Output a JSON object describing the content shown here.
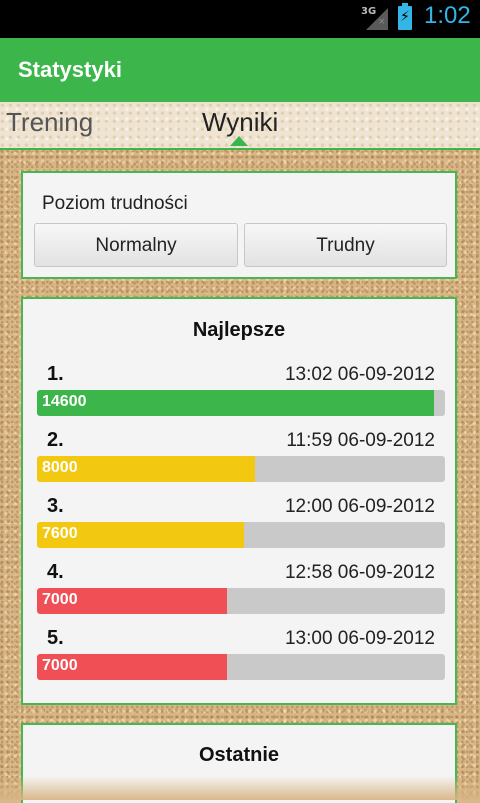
{
  "status_bar": {
    "network": "3G",
    "time": "1:02",
    "icons": [
      "signal-icon",
      "battery-charging-icon"
    ]
  },
  "app": {
    "title": "Statystyki"
  },
  "tabs": [
    {
      "label": "Trening",
      "selected": false
    },
    {
      "label": "Wyniki",
      "selected": true
    }
  ],
  "difficulty": {
    "label": "Poziom trudności",
    "options": [
      "Normalny",
      "Trudny"
    ]
  },
  "best": {
    "title": "Najlepsze",
    "max_score": 15000,
    "entries": [
      {
        "rank": "1.",
        "date": "13:02 06-09-2012",
        "score": "14600",
        "value": 14600,
        "color": "#3cb54a"
      },
      {
        "rank": "2.",
        "date": "11:59 06-09-2012",
        "score": "8000",
        "value": 8000,
        "color": "#f2c811"
      },
      {
        "rank": "3.",
        "date": "12:00 06-09-2012",
        "score": "7600",
        "value": 7600,
        "color": "#f2c811"
      },
      {
        "rank": "4.",
        "date": "12:58 06-09-2012",
        "score": "7000",
        "value": 7000,
        "color": "#ef4f55"
      },
      {
        "rank": "5.",
        "date": "13:00 06-09-2012",
        "score": "7000",
        "value": 7000,
        "color": "#ef4f55"
      }
    ]
  },
  "recent": {
    "title": "Ostatnie"
  },
  "colors": {
    "accent": "#3cb54a",
    "status_blue": "#33b5e5"
  }
}
